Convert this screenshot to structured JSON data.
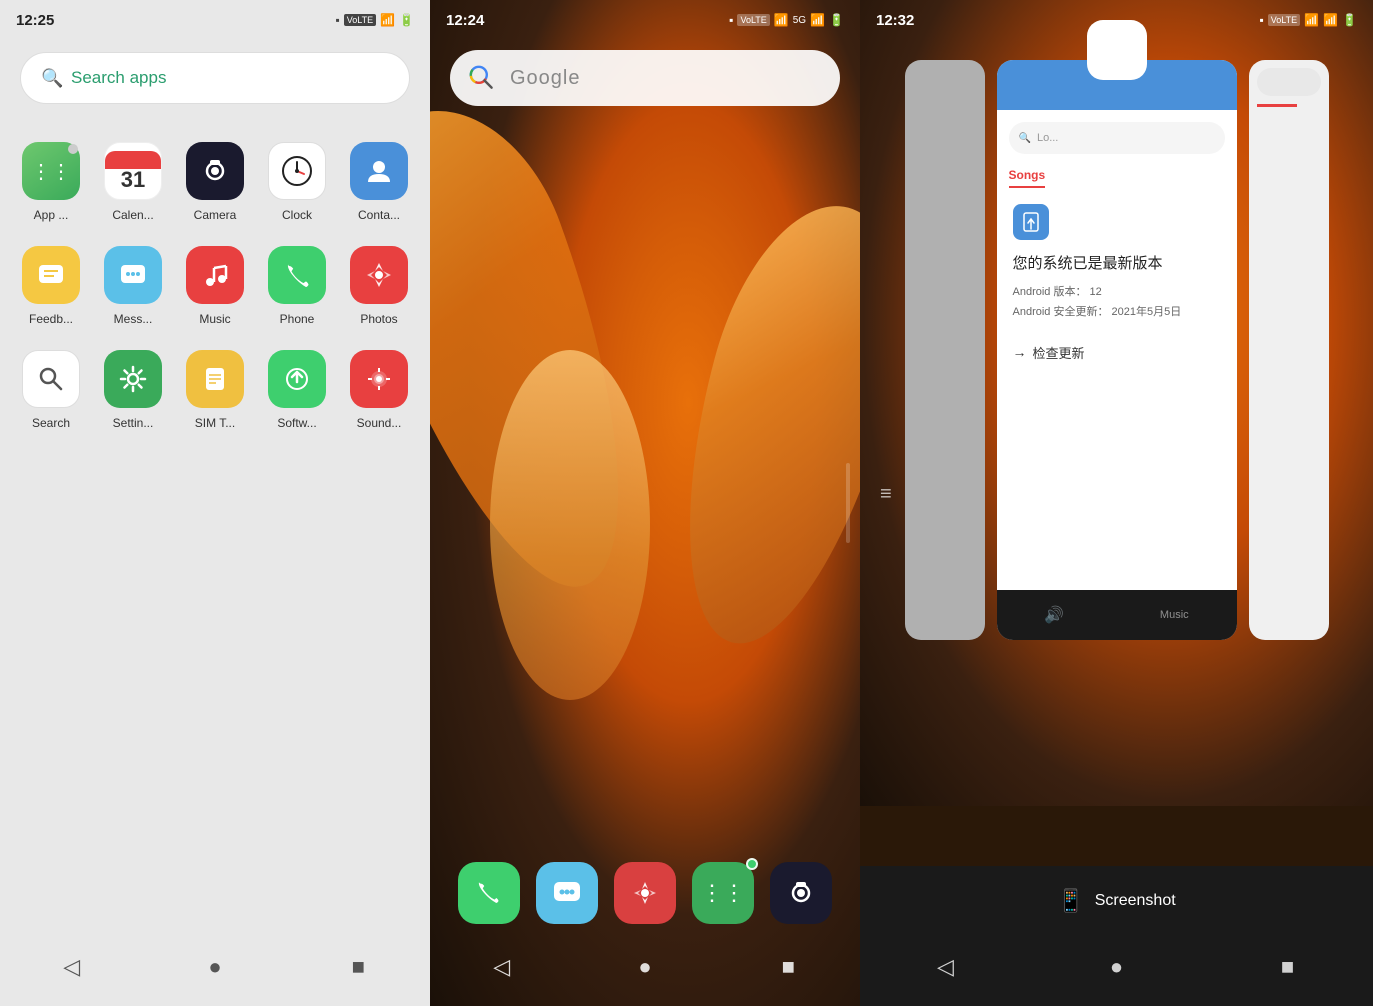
{
  "panel1": {
    "statusTime": "12:25",
    "searchPlaceholder": "Search apps",
    "apps": [
      {
        "id": "appvault",
        "label": "App ...",
        "iconClass": "icon-appvault",
        "symbol": "⋮⋮"
      },
      {
        "id": "calendar",
        "label": "Calen...",
        "iconClass": "icon-calendar",
        "symbol": "31"
      },
      {
        "id": "camera",
        "label": "Camera",
        "iconClass": "icon-camera",
        "symbol": "◉"
      },
      {
        "id": "clock",
        "label": "Clock",
        "iconClass": "icon-clock",
        "symbol": "⏱"
      },
      {
        "id": "contacts",
        "label": "Conta...",
        "iconClass": "icon-contacts",
        "symbol": "👤"
      },
      {
        "id": "feedback",
        "label": "Feedb...",
        "iconClass": "icon-feedback",
        "symbol": "💬"
      },
      {
        "id": "messages",
        "label": "Mess...",
        "iconClass": "icon-messages",
        "symbol": "💬"
      },
      {
        "id": "music",
        "label": "Music",
        "iconClass": "icon-music",
        "symbol": "♪"
      },
      {
        "id": "phone",
        "label": "Phone",
        "iconClass": "icon-phone",
        "symbol": "📞"
      },
      {
        "id": "photos",
        "label": "Photos",
        "iconClass": "icon-photos",
        "symbol": "📷"
      },
      {
        "id": "search",
        "label": "Search",
        "iconClass": "icon-search",
        "symbol": "🔍"
      },
      {
        "id": "settings",
        "label": "Settin...",
        "iconClass": "icon-settings",
        "symbol": "⚙"
      },
      {
        "id": "simt",
        "label": "SIM T...",
        "iconClass": "icon-simt",
        "symbol": "📋"
      },
      {
        "id": "software",
        "label": "Softw...",
        "iconClass": "icon-software",
        "symbol": "↑"
      },
      {
        "id": "sound",
        "label": "Sound...",
        "iconClass": "icon-sound",
        "symbol": "🔊"
      }
    ],
    "nav": {
      "back": "◁",
      "home": "●",
      "recents": "■"
    }
  },
  "panel2": {
    "statusTime": "12:24",
    "googlePlaceholder": "Google",
    "dockApps": [
      {
        "id": "phone",
        "symbol": "📞",
        "color": "#3ecf6e"
      },
      {
        "id": "messages",
        "symbol": "💬",
        "color": "#5bc0e8"
      },
      {
        "id": "photos",
        "symbol": "🌸",
        "color": "#e84040"
      },
      {
        "id": "appvault",
        "symbol": "⋮⋮",
        "color": "#3aaa5a",
        "hasBadge": true
      },
      {
        "id": "camera",
        "symbol": "◉",
        "color": "#1a1a2e"
      }
    ],
    "nav": {
      "back": "◁",
      "home": "●",
      "recents": "■"
    }
  },
  "panel3": {
    "statusTime": "12:32",
    "recentApps": {
      "leftCard": "gray",
      "midCard": {
        "title": "您的系统已是最新版本",
        "android_version_label": "Android 版本：",
        "android_version": "12",
        "security_label": "Android 安全更新：",
        "security_date": "2021年5月5日",
        "check_update_label": "检查更新",
        "songs_tab": "Songs"
      },
      "rightCard": "partial"
    },
    "screenshotLabel": "Screenshot",
    "nav": {
      "back": "◁",
      "home": "●",
      "recents": "■"
    },
    "menuIcon": "≡"
  }
}
